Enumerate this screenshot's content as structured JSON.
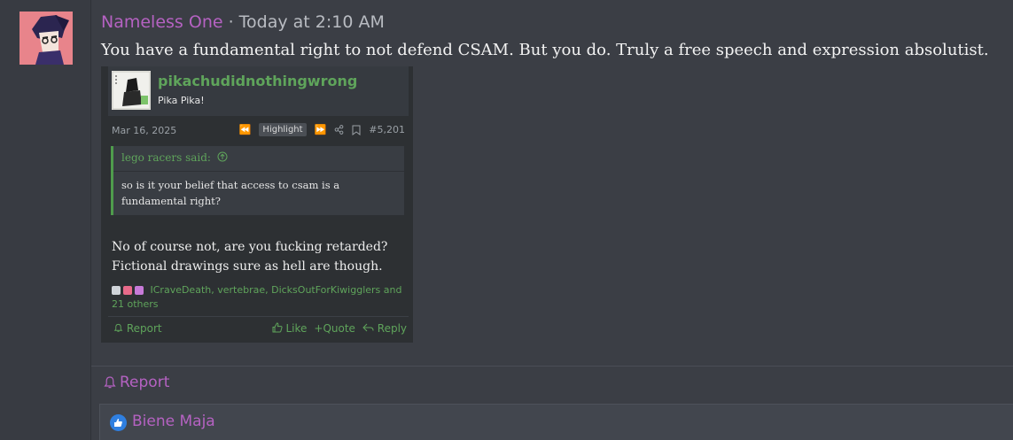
{
  "post": {
    "username": "Nameless One",
    "separator": " · ",
    "timestamp": "Today at 2:10 AM",
    "message": "You have a fundamental right to not defend CSAM. But you do. Truly a free speech and expression absolutist."
  },
  "embedded": {
    "username": "pikachudidnothingwrong",
    "user_title": "Pika Pika!",
    "date": "Mar 16, 2025",
    "highlight_label": "Highlight",
    "post_number": "#5,201",
    "quote_author": "lego racers said:",
    "quote_text": "so is it your belief that access to csam is a fundamental right?",
    "body_line1": "No of course not, are you fucking retarded?",
    "body_line2": "Fictional drawings sure as hell are though.",
    "reactions_text": "ICraveDeath, vertebrae, DicksOutForKiwigglers and 21 others",
    "report_label": "Report",
    "like_label": "Like",
    "quote_label": "Quote",
    "reply_label": "Reply"
  },
  "footer": {
    "report_label": "Report",
    "reactor_name": "Biene Maja"
  },
  "colors": {
    "username": "#b562c2",
    "embed_accent": "#5fa45b",
    "like_blue": "#2f7fe0"
  },
  "icons": {
    "report": "bell-icon",
    "like": "thumbs-up-icon",
    "quote_up": "arrow-up-circle-icon",
    "share": "share-icon",
    "bookmark": "bookmark-icon"
  }
}
